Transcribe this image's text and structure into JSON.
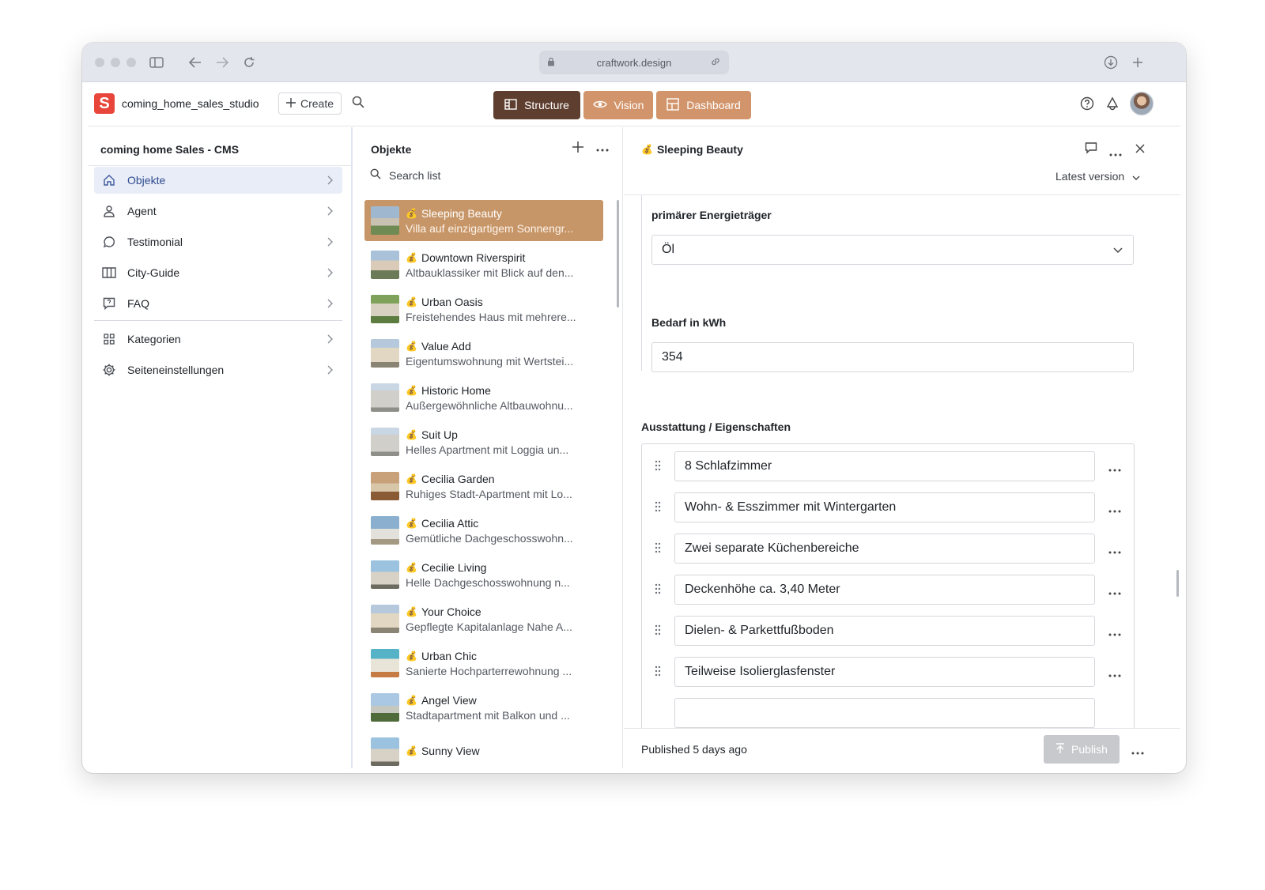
{
  "browser": {
    "url": "craftwork.design",
    "icons": [
      "sidebar-toggle-icon",
      "back-arrow-icon",
      "forward-arrow-icon",
      "reload-icon",
      "lock-icon",
      "link-icon",
      "download-icon",
      "new-tab-icon"
    ]
  },
  "header": {
    "studio_name": "coming_home_sales_studio",
    "create_label": "Create",
    "tools": [
      {
        "label": "Structure",
        "icon": "structure-icon",
        "active": true
      },
      {
        "label": "Vision",
        "icon": "eye-icon",
        "active": false
      },
      {
        "label": "Dashboard",
        "icon": "dashboard-icon",
        "active": false
      }
    ],
    "colors": {
      "brand": "#e8463a",
      "active_tool": "#5e3e2e",
      "tool": "#d2956b"
    }
  },
  "nav": {
    "title": "coming home Sales - CMS",
    "items": [
      {
        "label": "Objekte",
        "icon": "home-icon",
        "active": true
      },
      {
        "label": "Agent",
        "icon": "user-icon",
        "active": false
      },
      {
        "label": "Testimonial",
        "icon": "comment-icon",
        "active": false
      },
      {
        "label": "City-Guide",
        "icon": "map-icon",
        "active": false
      },
      {
        "label": "FAQ",
        "icon": "help-icon",
        "active": false
      },
      {
        "label": "Kategorien",
        "icon": "grid-icon",
        "active": false
      },
      {
        "label": "Seiteneinstellungen",
        "icon": "gear-icon",
        "active": false
      }
    ]
  },
  "list": {
    "title": "Objekte",
    "search_placeholder": "Search list",
    "items": [
      {
        "title": "Sleeping Beauty",
        "subtitle": "Villa auf einzigartigem Sonnengr...",
        "selected": true
      },
      {
        "title": "Downtown Riverspirit",
        "subtitle": "Altbauklassiker mit Blick auf den...",
        "selected": false
      },
      {
        "title": "Urban Oasis",
        "subtitle": "Freistehendes Haus mit mehrere...",
        "selected": false
      },
      {
        "title": "Value Add",
        "subtitle": "Eigentumswohnung mit Wertstei...",
        "selected": false
      },
      {
        "title": "Historic Home",
        "subtitle": "Außergewöhnliche Altbauwohnu...",
        "selected": false
      },
      {
        "title": "Suit Up",
        "subtitle": "Helles Apartment mit Loggia un...",
        "selected": false
      },
      {
        "title": "Cecilia Garden",
        "subtitle": "Ruhiges Stadt-Apartment mit Lo...",
        "selected": false
      },
      {
        "title": "Cecilia Attic",
        "subtitle": "Gemütliche Dachgeschosswohn...",
        "selected": false
      },
      {
        "title": "Cecilie Living",
        "subtitle": "Helle Dachgeschosswohnung n...",
        "selected": false
      },
      {
        "title": "Your Choice",
        "subtitle": "Gepflegte Kapitalanlage Nahe A...",
        "selected": false
      },
      {
        "title": "Urban Chic",
        "subtitle": "Sanierte Hochparterrewohnung ...",
        "selected": false
      },
      {
        "title": "Angel View",
        "subtitle": "Stadtapartment mit Balkon und ...",
        "selected": false
      },
      {
        "title": "Sunny View",
        "subtitle": "",
        "selected": false
      }
    ]
  },
  "document": {
    "title": "Sleeping Beauty",
    "version_label": "Latest version",
    "fields": {
      "energy_label": "primärer Energieträger",
      "energy_value": "Öl",
      "demand_label": "Bedarf in kWh",
      "demand_value": "354",
      "features_label": "Ausstattung / Eigenschaften"
    },
    "features": [
      "8 Schlafzimmer",
      "Wohn- & Esszimmer mit Wintergarten",
      "Zwei separate Küchenbereiche",
      "Deckenhöhe ca. 3,40 Meter",
      "Dielen- & Parkettfußboden",
      "Teilweise Isolierglasfenster"
    ],
    "footer": {
      "status": "Published 5 days ago",
      "publish_label": "Publish"
    }
  }
}
